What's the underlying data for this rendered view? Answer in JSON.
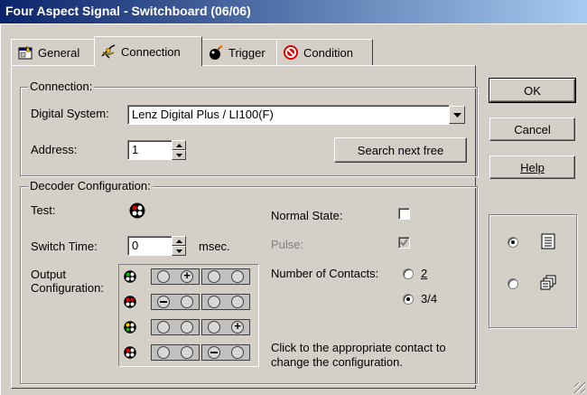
{
  "window": {
    "title": "Four Aspect Signal - Switchboard (06/06)"
  },
  "tabs": [
    {
      "label": "General",
      "icon": "properties-icon"
    },
    {
      "label": "Connection",
      "icon": "connection-icon"
    },
    {
      "label": "Trigger",
      "icon": "bomb-icon"
    },
    {
      "label": "Condition",
      "icon": "no-entry-icon"
    }
  ],
  "connection": {
    "group_title": "Connection:",
    "digital_system_label": "Digital System:",
    "digital_system_value": "Lenz Digital Plus / LI100(F)",
    "address_label": "Address:",
    "address_value": "1",
    "search_button": "Search next free"
  },
  "decoder": {
    "group_title": "Decoder Configuration:",
    "test_label": "Test:",
    "switch_time_label": "Switch Time:",
    "switch_time_value": "0",
    "switch_time_unit": "msec.",
    "output_label_1": "Output",
    "output_label_2": "Configuration:",
    "normal_state_label": "Normal State:",
    "normal_state_checked": false,
    "pulse_label": "Pulse:",
    "pulse_checked": true,
    "contacts_label": "Number of Contacts:",
    "contacts_options": [
      "2",
      "3/4"
    ],
    "contacts_selected": "3/4",
    "hint": "Click to the appropriate contact to change the configuration.",
    "rows": [
      {
        "aspect": "green",
        "contacts": [
          "none",
          "plus",
          "none",
          "none"
        ]
      },
      {
        "aspect": "red",
        "contacts": [
          "minus",
          "none",
          "none",
          "none"
        ]
      },
      {
        "aspect": "yellow-green",
        "contacts": [
          "none",
          "none",
          "none",
          "plus"
        ]
      },
      {
        "aspect": "red-white",
        "contacts": [
          "none",
          "none",
          "minus",
          "none"
        ]
      }
    ]
  },
  "buttons": {
    "ok": "OK",
    "cancel": "Cancel",
    "help": "Help"
  },
  "view_options": {
    "list_selected": true,
    "icons_selected": false
  }
}
